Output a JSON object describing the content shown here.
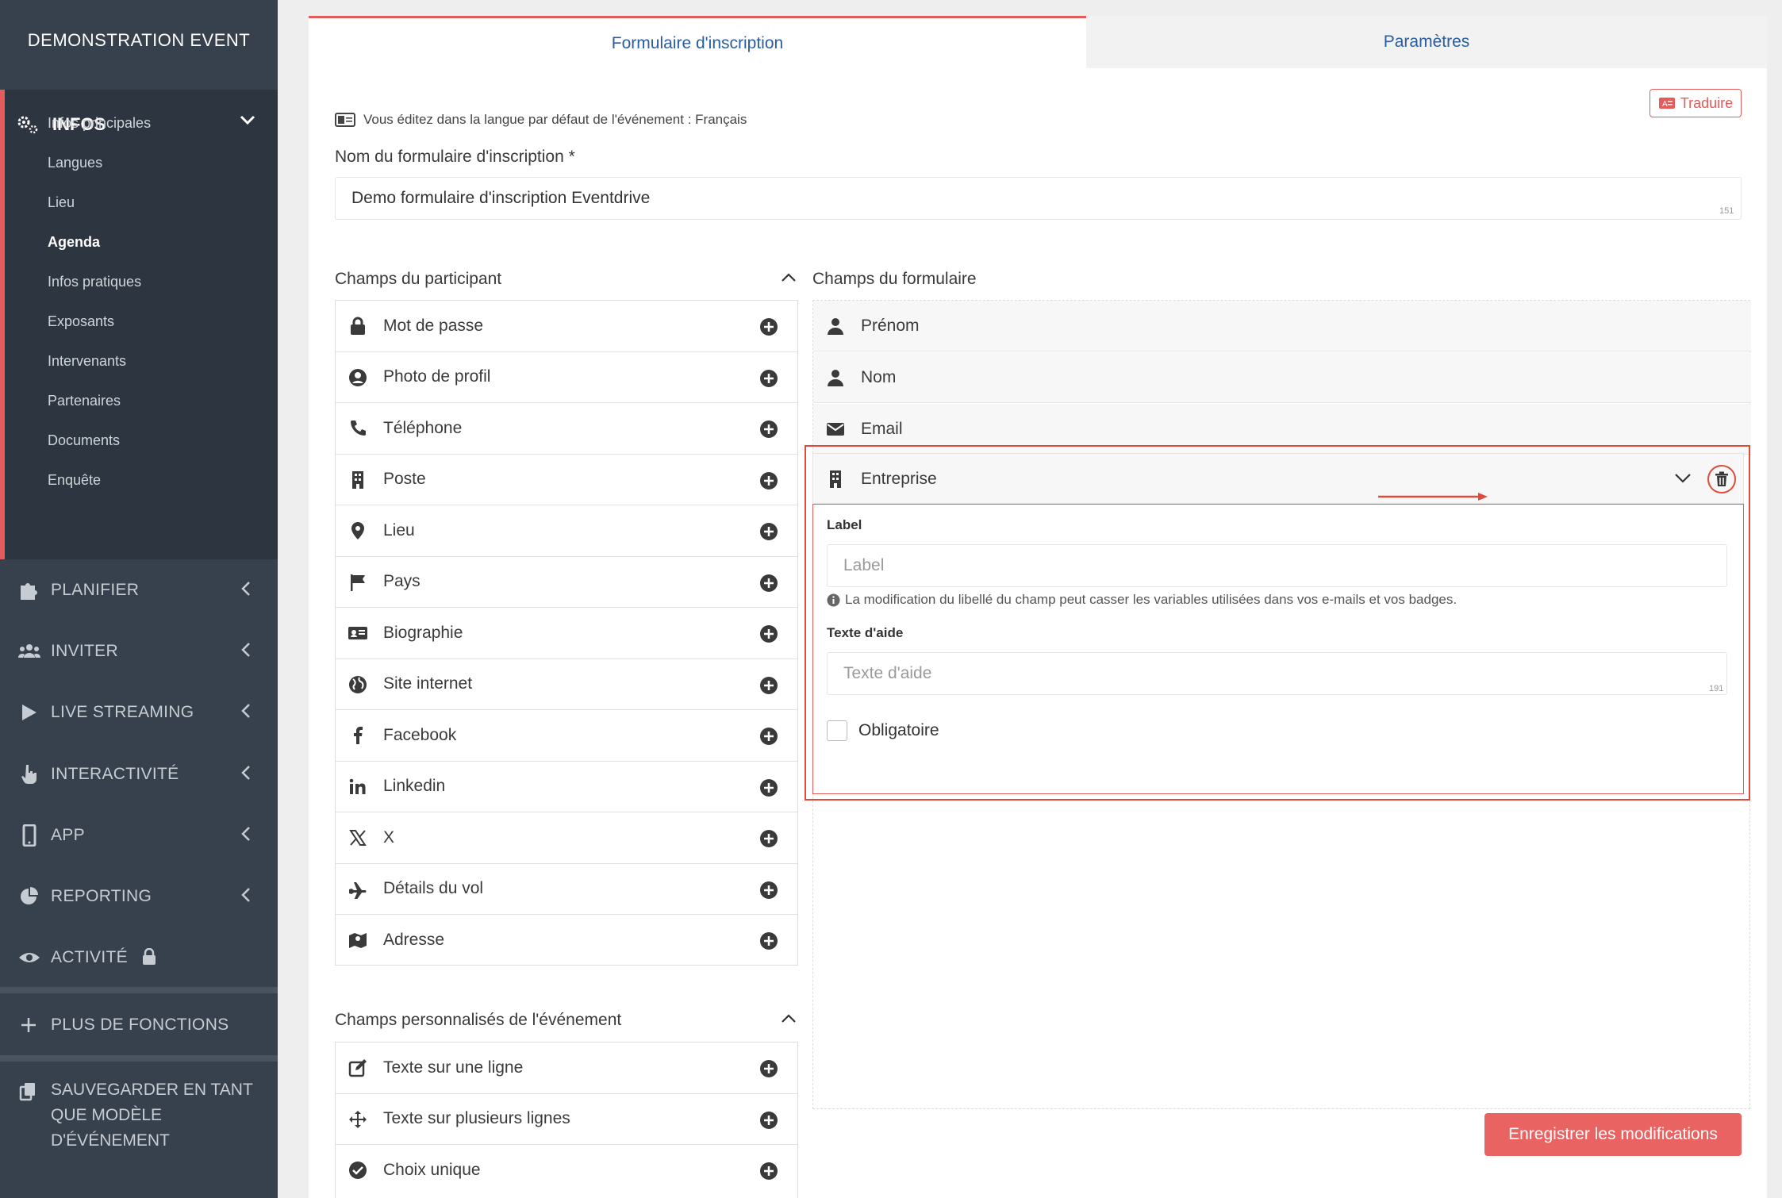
{
  "sidebar": {
    "event_name": "DEMONSTRATION EVENT",
    "infos": {
      "label": "INFOS",
      "items": [
        {
          "label": "Infos principales"
        },
        {
          "label": "Langues"
        },
        {
          "label": "Lieu"
        },
        {
          "label": "Agenda",
          "active": true
        },
        {
          "label": "Infos pratiques"
        },
        {
          "label": "Exposants"
        },
        {
          "label": "Intervenants"
        },
        {
          "label": "Partenaires"
        },
        {
          "label": "Documents"
        },
        {
          "label": "Enquête"
        }
      ]
    },
    "menu": [
      {
        "label": "PLANIFIER",
        "icon": "puzzle-icon"
      },
      {
        "label": "INVITER",
        "icon": "users-icon"
      },
      {
        "label": "LIVE STREAMING",
        "icon": "play-icon"
      },
      {
        "label": "INTERACTIVITÉ",
        "icon": "hand-pointer-icon"
      },
      {
        "label": "APP",
        "icon": "mobile-icon"
      },
      {
        "label": "REPORTING",
        "icon": "pie-chart-icon"
      },
      {
        "label": "ACTIVITÉ",
        "icon": "eye-icon"
      }
    ],
    "more_functions": "PLUS DE FONCTIONS",
    "save_template": "SAUVEGARDER EN TANT QUE MODÈLE D'ÉVÉNEMENT"
  },
  "tabs": {
    "form": "Formulaire d'inscription",
    "params": "Paramètres"
  },
  "translate_button": "Traduire",
  "lang_note": "Vous éditez dans la langue par défaut de l'événement : Français",
  "form_name": {
    "label": "Nom du formulaire d'inscription *",
    "value": "Demo formulaire d'inscription Eventdrive",
    "counter": "151"
  },
  "participant_fields": {
    "title": "Champs du participant",
    "items": [
      {
        "label": "Mot de passe",
        "icon": "lock-icon"
      },
      {
        "label": "Photo de profil",
        "icon": "user-circle-icon"
      },
      {
        "label": "Téléphone",
        "icon": "phone-icon"
      },
      {
        "label": "Poste",
        "icon": "building-icon"
      },
      {
        "label": "Lieu",
        "icon": "map-pin-icon"
      },
      {
        "label": "Pays",
        "icon": "flag-icon"
      },
      {
        "label": "Biographie",
        "icon": "id-card-icon"
      },
      {
        "label": "Site internet",
        "icon": "globe-icon"
      },
      {
        "label": "Facebook",
        "icon": "facebook-icon"
      },
      {
        "label": "Linkedin",
        "icon": "linkedin-icon"
      },
      {
        "label": "X",
        "icon": "x-icon"
      },
      {
        "label": "Détails du vol",
        "icon": "plane-icon"
      },
      {
        "label": "Adresse",
        "icon": "map-icon"
      }
    ]
  },
  "custom_fields": {
    "title": "Champs personnalisés de l'événement",
    "items": [
      {
        "label": "Texte sur une ligne",
        "icon": "edit-icon"
      },
      {
        "label": "Texte sur plusieurs lignes",
        "icon": "arrows-icon"
      },
      {
        "label": "Choix unique",
        "icon": "check-circle-icon"
      }
    ]
  },
  "form_fields": {
    "title": "Champs du formulaire",
    "fixed": [
      {
        "label": "Prénom",
        "icon": "user-icon"
      },
      {
        "label": "Nom",
        "icon": "user-icon"
      },
      {
        "label": "Email",
        "icon": "envelope-icon"
      }
    ],
    "expanded": {
      "label": "Entreprise",
      "icon": "building-icon",
      "label_field": {
        "title": "Label",
        "placeholder": "Label"
      },
      "info": "La modification du libellé du champ peut casser les variables utilisées dans vos e-mails et vos badges.",
      "help_field": {
        "title": "Texte d'aide",
        "placeholder": "Texte d'aide",
        "counter": "191"
      },
      "required_label": "Obligatoire"
    }
  },
  "save_button": "Enregistrer les modifications",
  "colors": {
    "accent": "#e45b5b",
    "link": "#2a5d9f",
    "sidebar": "#37404d"
  }
}
